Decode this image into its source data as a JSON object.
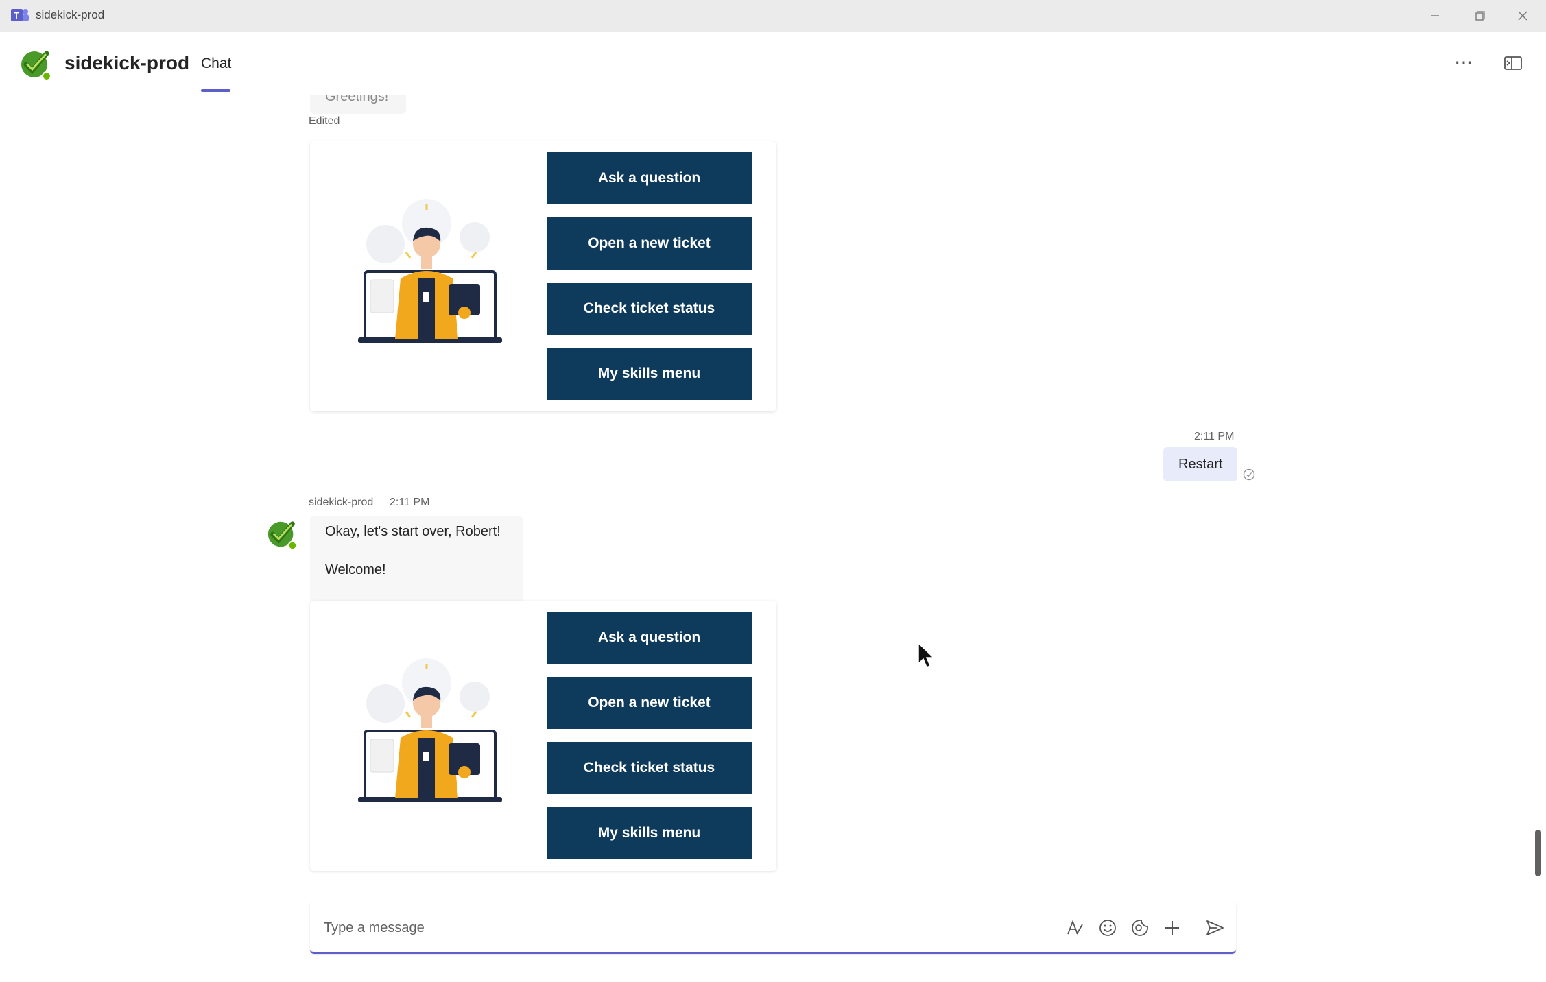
{
  "window": {
    "title": "sidekick-prod"
  },
  "header": {
    "bot_name": "sidekick-prod",
    "tab_chat": "Chat"
  },
  "first_message": {
    "text_partial": "Greetings!",
    "edited_label": "Edited"
  },
  "menu_buttons": {
    "ask": "Ask a question",
    "open_ticket": "Open a new ticket",
    "check_status": "Check ticket status",
    "skills": "My skills menu"
  },
  "user_message": {
    "time": "2:11 PM",
    "text": "Restart"
  },
  "bot_message": {
    "sender": "sidekick-prod",
    "time": "2:11 PM",
    "line1": "Okay, let's start over, Robert!",
    "line2": "Welcome!"
  },
  "composer": {
    "placeholder": "Type a message"
  },
  "colors": {
    "accent": "#5b5fc7",
    "button_bg": "#0e3a5c",
    "sent_bubble": "#e8ebfa"
  }
}
